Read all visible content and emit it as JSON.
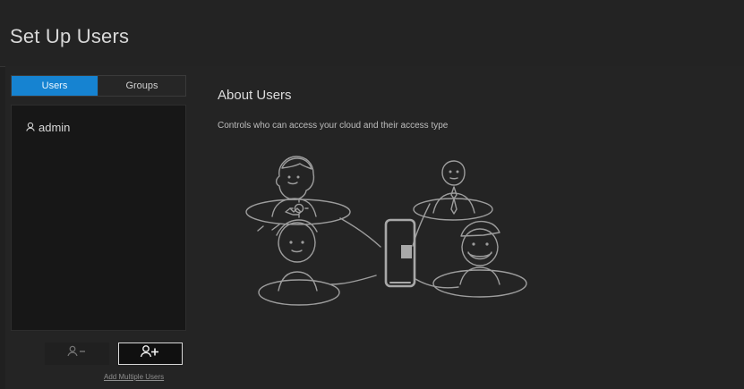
{
  "window": {
    "title": "Set Up Users"
  },
  "sidebar": {
    "tabs": [
      {
        "label": "Users",
        "active": true
      },
      {
        "label": "Groups",
        "active": false
      }
    ],
    "users": [
      {
        "name": "admin",
        "icon": "user-icon"
      }
    ],
    "actions": {
      "remove_icon": "remove-user-icon",
      "add_icon": "add-user-icon",
      "add_multiple_label": "Add Multiple Users"
    }
  },
  "main": {
    "about_title": "About Users",
    "about_description": "Controls who can access your cloud and their access type"
  },
  "colors": {
    "accent": "#1683d1",
    "background": "#202020",
    "panel": "#242424",
    "text": "#d8d8d8"
  }
}
